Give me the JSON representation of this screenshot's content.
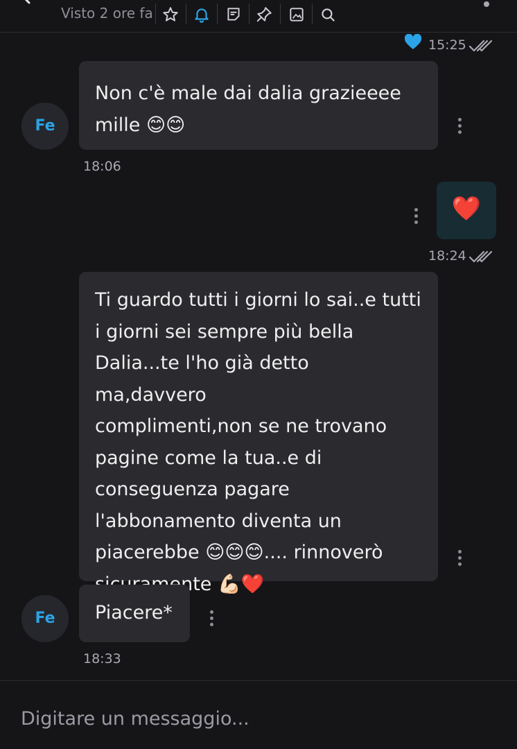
{
  "header": {
    "status": "Visto 2 ore fa",
    "icons": [
      "back-arrow-icon",
      "star-icon",
      "bell-icon",
      "note-icon",
      "pin-icon",
      "image-icon",
      "search-icon",
      "more-options-icon"
    ],
    "accent": "#2aa4e6"
  },
  "receipt_top": {
    "time": "15:25",
    "reaction": "blue-heart-icon",
    "read": "double-check-icon"
  },
  "messages": [
    {
      "direction": "incoming",
      "avatar": "Fe",
      "text": "Non c'è male dai dalia grazieeee\nmille 😊😊",
      "time": "18:06"
    },
    {
      "direction": "outgoing",
      "text": "❤️",
      "time": "18:24"
    },
    {
      "direction": "incoming",
      "text": "Ti guardo tutti i giorni lo sai..e tutti\ni giorni sei sempre più bella\nDalia...te l'ho già detto ma,davvero\ncomplimenti,non se ne trovano\npagine come la tua..e di\nconseguenza pagare\nl'abbonamento diventa un\npiacerebbe 😊😊😊.... rinnoverò\nsicuramente 💪🏻❤️"
    },
    {
      "direction": "incoming",
      "avatar": "Fe",
      "text": "Piacere*",
      "time": "18:33"
    }
  ],
  "composer": {
    "placeholder": "Digitare un messaggio..."
  },
  "colors": {
    "background": "#151518",
    "incoming_bubble": "#2a2a2f",
    "outgoing_bubble": "#172c33",
    "muted_text": "#a9a9b2"
  }
}
